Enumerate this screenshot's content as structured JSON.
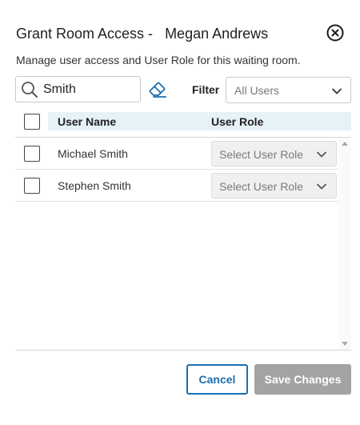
{
  "dialog": {
    "title_prefix": "Grant Room Access -   ",
    "title_user": "Megan Andrews",
    "subtitle": "Manage user access and User Role for this waiting room."
  },
  "icons": {
    "close": "close-circle-icon",
    "search": "search-icon",
    "clear": "eraser-icon",
    "chevron": "chevron-down-icon"
  },
  "search": {
    "value": "Smith"
  },
  "filter": {
    "label": "Filter",
    "selected": "All Users"
  },
  "table": {
    "headers": {
      "name": "User Name",
      "role": "User Role"
    },
    "rows": [
      {
        "name": "Michael Smith",
        "role_placeholder": "Select User Role"
      },
      {
        "name": "Stephen Smith",
        "role_placeholder": "Select User Role"
      }
    ]
  },
  "actions": {
    "cancel": "Cancel",
    "save": "Save Changes"
  },
  "colors": {
    "accent": "#1b6fb0",
    "header_bg": "#e6f1f8",
    "disabled_button": "#a3a3a3"
  }
}
